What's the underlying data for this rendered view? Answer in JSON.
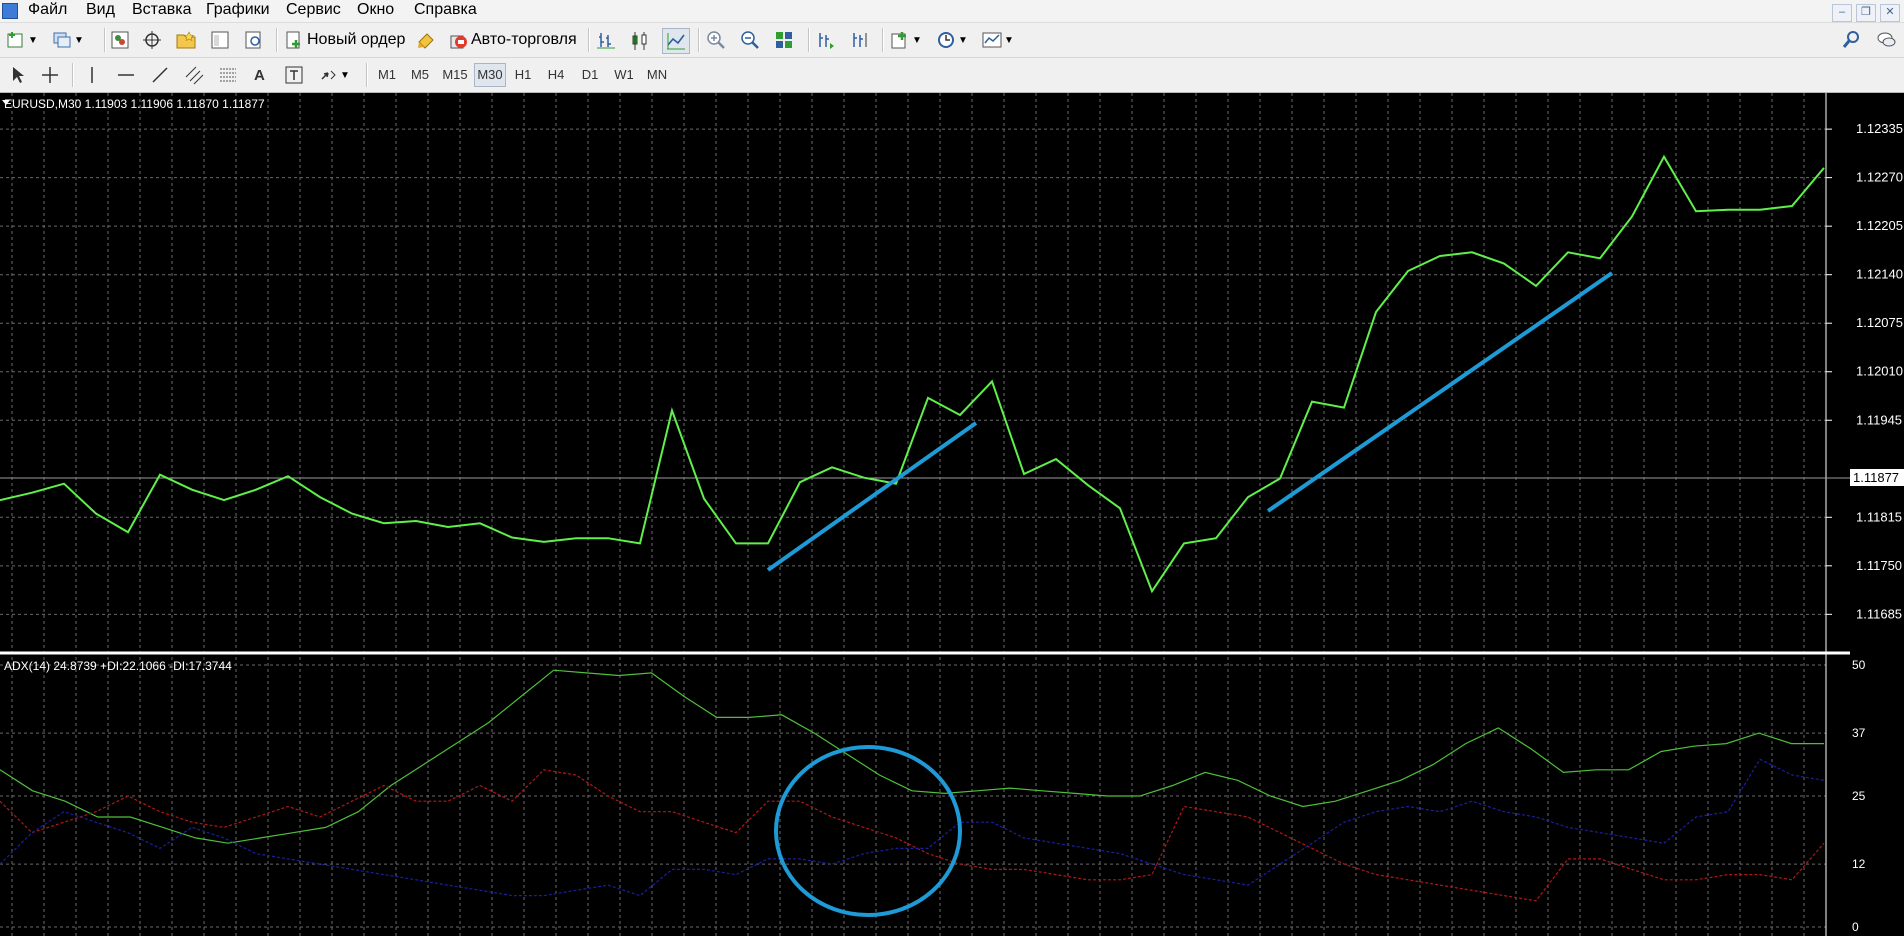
{
  "menu": {
    "items": [
      "Файл",
      "Вид",
      "Вставка",
      "Графики",
      "Сервис",
      "Окно",
      "Справка"
    ]
  },
  "toolbar": {
    "new_order_label": "Новый ордер",
    "auto_trading_label": "Авто-торговля"
  },
  "timeframes": [
    "M1",
    "M5",
    "M15",
    "M30",
    "H1",
    "H4",
    "D1",
    "W1",
    "MN"
  ],
  "active_timeframe": "M30",
  "price_chart": {
    "header": "EURUSD,M30  1.11903 1.11906 1.11870 1.11877",
    "y_ticks": [
      "1.12335",
      "1.12270",
      "1.12205",
      "1.12140",
      "1.12075",
      "1.12010",
      "1.11945",
      "1.11877",
      "1.11815",
      "1.11750",
      "1.11685"
    ],
    "current_price": "1.11877",
    "line_color": "#5ff04a",
    "annotation_color": "#1e9bd7"
  },
  "indicator": {
    "header": "ADX(14) 24.8739 +DI:22.1066 -DI:17.3744",
    "y_ticks": [
      "50",
      "37",
      "25",
      "12",
      "0"
    ],
    "adx_color": "#4fbf3a",
    "plus_di_color": "#b01818",
    "minus_di_color": "#1a1fa0"
  },
  "chart_data": [
    {
      "type": "line",
      "title": "EURUSD,M30",
      "ylim": [
        1.1166,
        1.1237
      ],
      "series": [
        {
          "name": "EURUSD",
          "values": [
            1.11838,
            1.11848,
            1.1186,
            1.1182,
            1.11795,
            1.11872,
            1.11852,
            1.11838,
            1.11852,
            1.1187,
            1.11842,
            1.1182,
            1.11807,
            1.1181,
            1.11802,
            1.11807,
            1.11788,
            1.11782,
            1.11787,
            1.11787,
            1.1178,
            1.11958,
            1.1184,
            1.1178,
            1.1178,
            1.11862,
            1.11882,
            1.11868,
            1.1186,
            1.11975,
            1.11952,
            1.11997,
            1.11873,
            1.11893,
            1.11858,
            1.11827,
            1.11716,
            1.1178,
            1.11787,
            1.11842,
            1.11867,
            1.1197,
            1.11962,
            1.1209,
            1.12145,
            1.12165,
            1.1217,
            1.12155,
            1.12125,
            1.1217,
            1.12162,
            1.12218,
            1.12298,
            1.12225,
            1.12227,
            1.12227,
            1.12232,
            1.12283
          ]
        }
      ],
      "annotations": [
        "trend line 1",
        "trend line 2"
      ]
    },
    {
      "type": "line",
      "title": "ADX(14) 24.8739 +DI:22.1066 -DI:17.3744",
      "ylim": [
        0,
        50
      ],
      "series": [
        {
          "name": "ADX",
          "values": [
            30,
            26,
            24,
            21,
            21,
            19,
            17,
            16,
            17,
            18,
            19,
            22,
            27,
            31,
            35,
            39,
            44,
            49,
            48.5,
            48,
            48.5,
            44,
            40,
            40,
            40.5,
            37,
            33,
            29,
            26,
            25.5,
            26,
            26.5,
            26,
            25.5,
            25,
            25,
            27,
            29.5,
            28,
            25,
            23,
            24,
            26,
            28,
            31,
            35,
            38,
            34,
            29.5,
            30,
            30,
            33.5,
            34.5,
            35,
            37,
            35,
            35
          ]
        },
        {
          "name": "+DI",
          "values": [
            24,
            18,
            20,
            22,
            25,
            22,
            20,
            19,
            21,
            23,
            21,
            24,
            27,
            24,
            24,
            27,
            24,
            30,
            29,
            25,
            22,
            22,
            20,
            18,
            24,
            24,
            21,
            19,
            17,
            14,
            12,
            11,
            11,
            10,
            9,
            9,
            10,
            23,
            22,
            21,
            18,
            15,
            12,
            10,
            9,
            8,
            7,
            6,
            5,
            13,
            13,
            11,
            9,
            9,
            10,
            10,
            9,
            16
          ]
        },
        {
          "name": "-DI",
          "values": [
            12,
            18,
            22,
            20,
            18,
            15,
            19,
            17,
            14,
            13,
            12,
            11,
            10,
            9,
            8,
            7,
            6,
            6,
            7,
            8,
            6,
            11,
            11,
            10,
            13,
            13,
            12,
            14,
            15,
            15,
            20,
            20,
            17,
            16,
            15,
            14,
            12,
            10,
            9,
            8,
            12,
            16,
            20,
            22,
            23,
            22,
            24,
            22,
            21,
            19,
            18,
            17,
            16,
            21,
            22,
            32,
            29,
            28
          ]
        }
      ]
    }
  ]
}
